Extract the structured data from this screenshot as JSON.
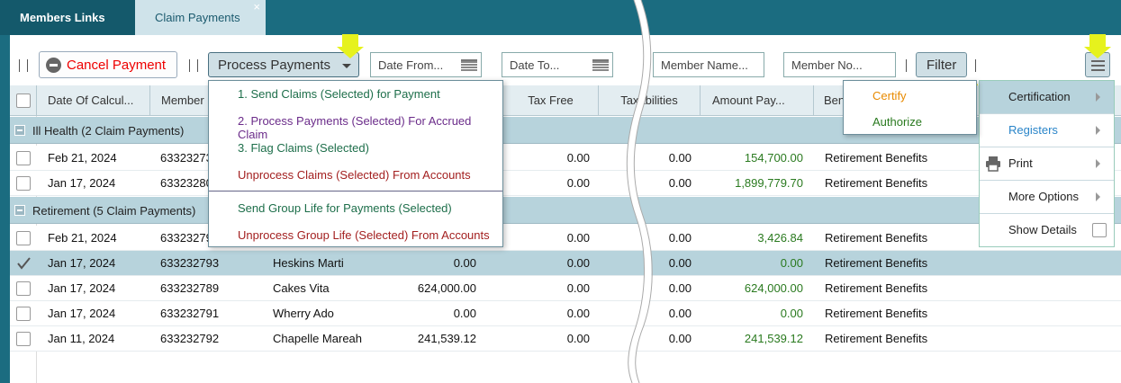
{
  "tabs": [
    {
      "label": "Members Links"
    },
    {
      "label": "Claim Payments",
      "close": "×"
    }
  ],
  "toolbar": {
    "cancel_label": "Cancel Payment",
    "process_label": "Process Payments",
    "date_from_placeholder": "Date From...",
    "date_to_placeholder": "Date To...",
    "member_name_placeholder": "Member Name...",
    "member_no_placeholder": "Member No...",
    "filter_label": "Filter"
  },
  "columns": [
    "Date Of Calcul...",
    "Member",
    "Tax Free",
    "Taxabilities",
    "Amount Pay...",
    "Ben"
  ],
  "groups": [
    {
      "label": "Ill Health (2 Claim Payments)"
    },
    {
      "label": "Retirement (5 Claim Payments)"
    }
  ],
  "rows": [
    {
      "date": "Feb 21, 2024",
      "member": "63323273",
      "name": "",
      "gross": "",
      "tax_free": "0.00",
      "taxable": "0.00",
      "amount": "154,700.00",
      "benefit": "Retirement Benefits",
      "checked": false
    },
    {
      "date": "Jan 17, 2024",
      "member": "63323280",
      "name": "",
      "gross": "",
      "tax_free": "0.00",
      "taxable": "0.00",
      "amount": "1,899,779.70",
      "benefit": "Retirement Benefits",
      "checked": false
    },
    {
      "date": "Feb 21, 2024",
      "member": "63323279",
      "name": "",
      "gross": "",
      "tax_free": "0.00",
      "taxable": "0.00",
      "amount": "3,426.84",
      "benefit": "Retirement Benefits",
      "checked": false
    },
    {
      "date": "Jan 17, 2024",
      "member": "633232793",
      "name": "Heskins Marti",
      "gross": "0.00",
      "tax_free": "0.00",
      "taxable": "0.00",
      "amount": "0.00",
      "benefit": "Retirement Benefits",
      "checked": true
    },
    {
      "date": "Jan 17, 2024",
      "member": "633232789",
      "name": "Cakes Vita",
      "gross": "624,000.00",
      "tax_free": "0.00",
      "taxable": "0.00",
      "amount": "624,000.00",
      "benefit": "Retirement Benefits",
      "checked": false
    },
    {
      "date": "Jan 17, 2024",
      "member": "633232791",
      "name": "Wherry Ado",
      "gross": "0.00",
      "tax_free": "0.00",
      "taxable": "0.00",
      "amount": "0.00",
      "benefit": "Retirement Benefits",
      "checked": false
    },
    {
      "date": "Jan 11, 2024",
      "member": "633232792",
      "name": "Chapelle Mareah",
      "gross": "241,539.12",
      "tax_free": "0.00",
      "taxable": "0.00",
      "amount": "241,539.12",
      "benefit": "Retirement Benefits",
      "checked": false
    }
  ],
  "process_menu": [
    {
      "label": "1. Send Claims (Selected) for Payment",
      "color": "#1d6e4a"
    },
    {
      "label": "2. Process Payments (Selected) For Accrued Claim",
      "color": "#6b2c8a"
    },
    {
      "label": "3. Flag Claims (Selected)",
      "color": "#1d6e4a"
    },
    {
      "label": "Unprocess Claims (Selected) From Accounts",
      "color": "#a32020"
    },
    {
      "label": "Send Group Life for Payments (Selected)",
      "color": "#1d6e4a"
    },
    {
      "label": "Unprocess Group Life (Selected) From Accounts",
      "color": "#a32020"
    }
  ],
  "side_menu": [
    {
      "label": "Certification",
      "submenu": true
    },
    {
      "label": "Registers",
      "submenu": true
    },
    {
      "label": "Print",
      "submenu": true
    },
    {
      "label": "More Options",
      "submenu": true
    },
    {
      "label": "Show Details",
      "checkbox": true
    }
  ],
  "certification_menu": [
    {
      "label": "Certify",
      "color": "#e88a00"
    },
    {
      "label": "Authorize",
      "color": "#2a7a1f"
    }
  ],
  "colors": {
    "tabbar": "#1b6c80",
    "group_row": "#b7d3dc",
    "header": "#e3edf1",
    "amount_green": "#2a7a1f",
    "cancel_red": "#e00000",
    "highlight_arrow": "#e6f21d"
  }
}
